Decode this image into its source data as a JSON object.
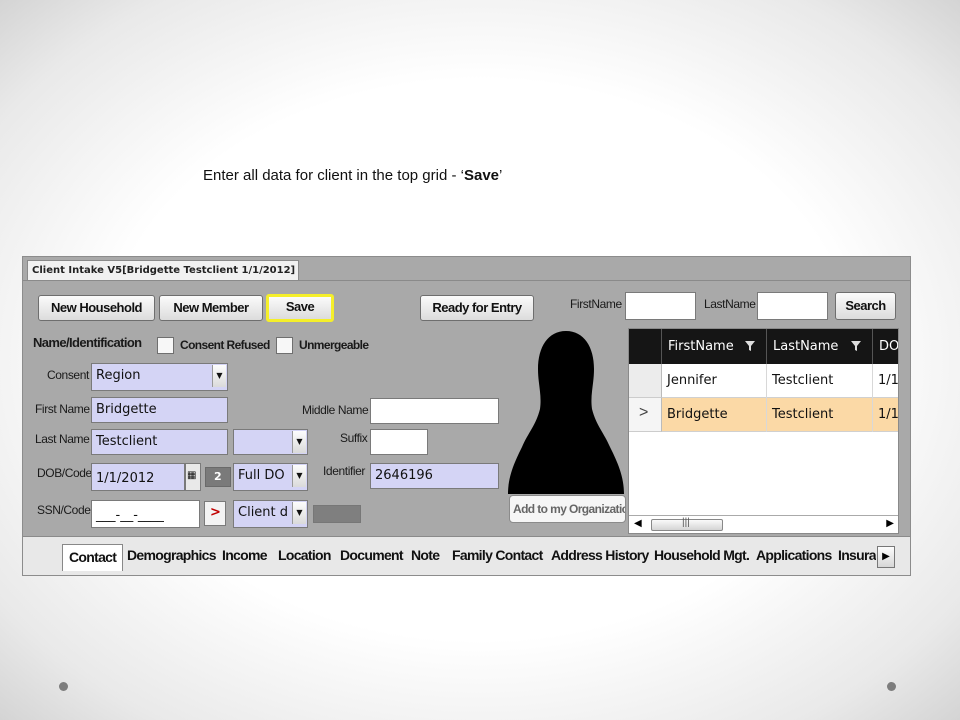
{
  "caption": {
    "prefix": "Enter all data for client in the top grid  -  ‘",
    "bold": "Save",
    "suffix": "’"
  },
  "window": {
    "tab_title": "Client Intake V5[Bridgette Testclient 1/1/2012]"
  },
  "toolbar": {
    "new_household": "New Household",
    "new_member": "New Member",
    "save": "Save",
    "ready_for_entry": "Ready for Entry",
    "firstname_label": "FirstName",
    "lastname_label": "LastName",
    "search": "Search",
    "firstname_value": "",
    "lastname_value": ""
  },
  "form": {
    "section_title": "Name/Identification",
    "consent_refused": "Consent Refused",
    "unmergeable": "Unmergeable",
    "consent_label": "Consent",
    "consent_value": "Region",
    "first_name_label": "First Name",
    "first_name_value": "Bridgette",
    "middle_name_label": "Middle Name",
    "middle_name_value": "",
    "last_name_label": "Last Name",
    "last_name_value": "Testclient",
    "suffix_label": "Suffix",
    "suffix_value": "",
    "dob_label": "DOB/Code",
    "dob_value": "1/1/2012",
    "dob_badge": "2",
    "dob_code_value": "Full DO",
    "identifier_label": "Identifier",
    "identifier_value": "2646196",
    "ssn_label": "SSN/Code",
    "ssn_value": "___-__-____",
    "ssn_arrow": ">",
    "ssn_code_value": "Client d"
  },
  "photo": {
    "add_org_button": "Add to my Organizatic"
  },
  "grid": {
    "columns": [
      "FirstName",
      "LastName",
      "DO"
    ],
    "rows": [
      {
        "first": "Jennifer",
        "last": "Testclient",
        "dob": "1/1"
      },
      {
        "first": "Bridgette",
        "last": "Testclient",
        "dob": "1/1"
      }
    ],
    "selected_row_marker": ">"
  },
  "bottom_tabs": [
    "Contact",
    "Demographics",
    "Income",
    "Location",
    "Document",
    "Note",
    "Family Contact",
    "Address History",
    "Household Mgt.",
    "Applications",
    "Insura"
  ],
  "colors": {
    "highlight_row": "#fbd9a6",
    "save_border": "#f5ef2a",
    "field_bg": "#d4d4f5"
  }
}
